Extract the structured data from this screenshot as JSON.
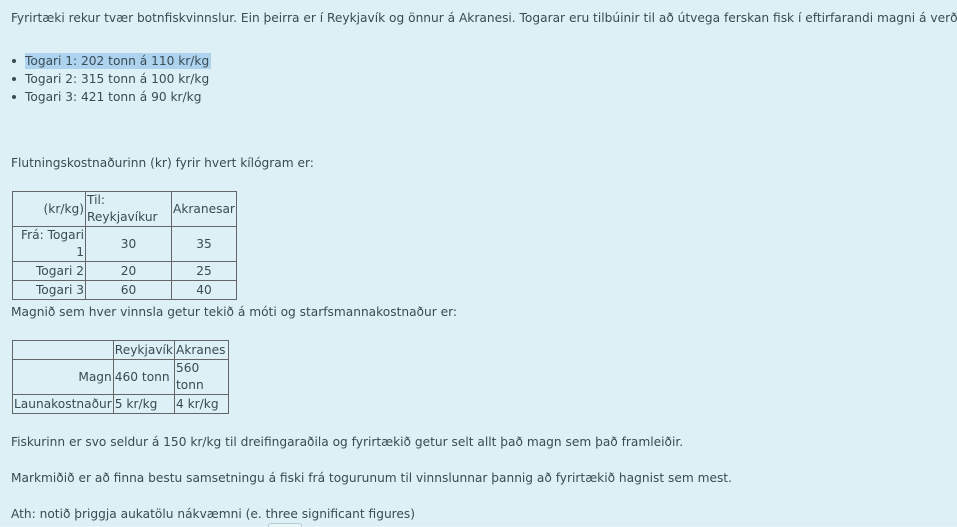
{
  "intro": "Fyrirtæki rekur tvær botnfiskvinnslur. Ein þeirra er í Reykjavík og önnur á Akranesi. Togarar eru tilbúinir til að útvega ferskan fisk í eftirfarandi magni á verði:",
  "trawlers": [
    "Togari 1: 202 tonn á 110 kr/kg",
    "Togari 2: 315 tonn á 100 kr/kg",
    "Togari 3: 421 tonn á 90 kr/kg"
  ],
  "shipping_intro": "Flutningskostnaðurinn (kr) fyrir hvert kílógram er:",
  "shipping_table": {
    "header": [
      "(kr/kg)",
      "Til: Reykjavíkur",
      "Akranesar"
    ],
    "rows": [
      [
        "Frá: Togari 1",
        "30",
        "35"
      ],
      [
        "Togari 2",
        "20",
        "25"
      ],
      [
        "Togari 3",
        "60",
        "40"
      ]
    ]
  },
  "capacity_intro": "Magnið sem hver vinnsla getur tekið á móti og starfsmannakostnaður er:",
  "capacity_table": {
    "header": [
      "",
      "Reykjavík",
      "Akranes"
    ],
    "rows": [
      [
        "Magn",
        "460 tonn",
        "560 tonn"
      ],
      [
        "Launakostnaður",
        "5 kr/kg",
        "4 kr/kg"
      ]
    ]
  },
  "sale_text": "Fiskurinn er svo seldur á 150 kr/kg til dreifingaraðila og fyrirtækið getur selt allt það magn sem það framleiðir.",
  "goal_text": "Markmiðið er að finna bestu samsetningu á fiski frá togurunum til vinnslunnar þannig að fyrirtækið hagnist sem mest.",
  "note_text": "Ath: notið þriggja aukatölu nákvæmni (e. three significant figures)"
}
